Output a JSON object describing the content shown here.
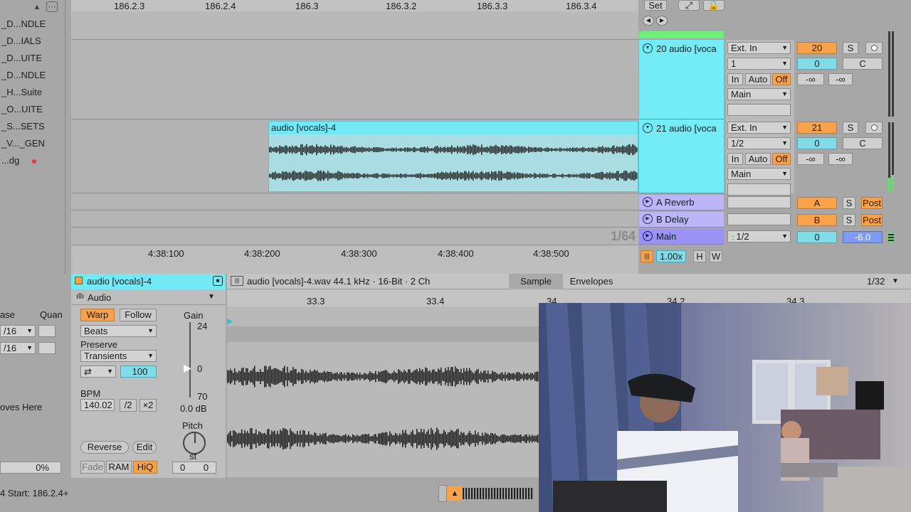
{
  "browser": {
    "items": [
      {
        "label": "_D...NDLE",
        "dot": false
      },
      {
        "label": "_D...IALS",
        "dot": false
      },
      {
        "label": "_D...UITE",
        "dot": false
      },
      {
        "label": "_D...NDLE",
        "dot": false
      },
      {
        "label": "_H...Suite",
        "dot": false
      },
      {
        "label": "_O...UITE",
        "dot": false
      },
      {
        "label": "_S...SETS",
        "dot": false
      },
      {
        "label": "_V..._GEN",
        "dot": false
      },
      {
        "label": "...dg",
        "dot": true
      }
    ],
    "col_phase": "ase",
    "col_quant": "Quan",
    "row1_val": "/16",
    "row2_val": "/16",
    "drop_hint": "oves Here",
    "percent": "0%"
  },
  "arrangement": {
    "beat_ruler": [
      "186.2.3",
      "186.2.4",
      "186.3",
      "186.3.2",
      "186.3.3",
      "186.3.4"
    ],
    "time_ruler": [
      "4:38:100",
      "4:38:200",
      "4:38:300",
      "4:38:400",
      "4:38:500"
    ],
    "clip_name": "audio [vocals]-4",
    "quantize": "1/64"
  },
  "transport": {
    "set_label": "Set",
    "zoom_value": "1.00x",
    "h_label": "H",
    "w_label": "W"
  },
  "tracks": [
    {
      "title": "20 audio [voca",
      "input": "Ext. In",
      "channel": "1",
      "number": "20",
      "solo": "S",
      "pan": "0",
      "pan_pos": "C",
      "in": "In",
      "auto": "Auto",
      "off": "Off",
      "out": "Main",
      "db1": "-∞",
      "db2": "-∞"
    },
    {
      "title": "21 audio [voca",
      "input": "Ext. In",
      "channel": "1/2",
      "number": "21",
      "solo": "S",
      "pan": "0",
      "pan_pos": "C",
      "in": "In",
      "auto": "Auto",
      "off": "Off",
      "out": "Main",
      "db1": "-∞",
      "db2": "-∞"
    }
  ],
  "returns": [
    {
      "title": "A Reverb",
      "letter": "A",
      "solo": "S",
      "post": "Post"
    },
    {
      "title": "B Delay",
      "letter": "B",
      "solo": "S",
      "post": "Post"
    }
  ],
  "main_track": {
    "title": "Main",
    "channel": "1/2",
    "value": "0",
    "db": "-6.0"
  },
  "clip_view": {
    "clip_title": "audio [vocals]-4",
    "device": "Audio",
    "file_info": "audio [vocals]-4.wav  44.1 kHz · 16-Bit · 2 Ch",
    "tab_sample": "Sample",
    "tab_envelopes": "Envelopes",
    "grid": "1/32",
    "ruler": [
      "33.3",
      "33.4",
      "34",
      "34.2",
      "34.3"
    ],
    "warp": "Warp",
    "follow": "Follow",
    "warp_mode": "Beats",
    "preserve_label": "Preserve",
    "preserve_mode": "Transients",
    "loop_value": "100",
    "bpm_label": "BPM",
    "bpm": "140.02",
    "half": "/2",
    "double": "×2",
    "gain_label": "Gain",
    "gain_top": "24",
    "gain_mid": "0",
    "gain_bottom": "70",
    "gain_db": "0.0 dB",
    "pitch_label": "Pitch",
    "pitch_unit": "st",
    "pitch_semi": "0",
    "pitch_cents": "0",
    "reverse": "Reverse",
    "edit": "Edit",
    "fade": "Fade",
    "ram": "RAM",
    "hiq": "HiQ"
  },
  "status_bar": {
    "text": "4  Start: 186.2.4+"
  },
  "colors": {
    "clip": "#73e9f6",
    "return": "#bcb5f7",
    "orange": "#f8a34b",
    "main": "#9c92f6"
  }
}
